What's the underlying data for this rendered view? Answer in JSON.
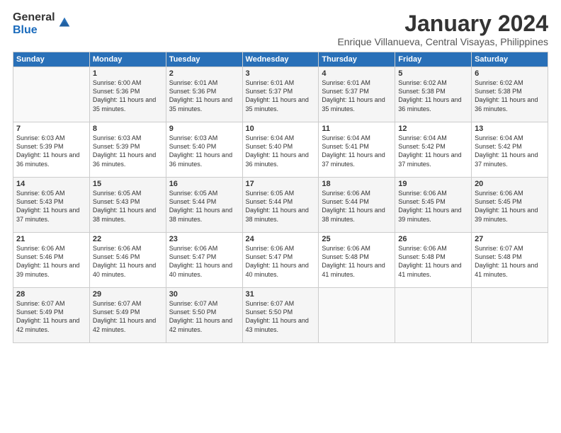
{
  "logo": {
    "general": "General",
    "blue": "Blue"
  },
  "title": "January 2024",
  "subtitle": "Enrique Villanueva, Central Visayas, Philippines",
  "headers": [
    "Sunday",
    "Monday",
    "Tuesday",
    "Wednesday",
    "Thursday",
    "Friday",
    "Saturday"
  ],
  "weeks": [
    [
      {
        "day": "",
        "sunrise": "",
        "sunset": "",
        "daylight": ""
      },
      {
        "day": "1",
        "sunrise": "Sunrise: 6:00 AM",
        "sunset": "Sunset: 5:36 PM",
        "daylight": "Daylight: 11 hours and 35 minutes."
      },
      {
        "day": "2",
        "sunrise": "Sunrise: 6:01 AM",
        "sunset": "Sunset: 5:36 PM",
        "daylight": "Daylight: 11 hours and 35 minutes."
      },
      {
        "day": "3",
        "sunrise": "Sunrise: 6:01 AM",
        "sunset": "Sunset: 5:37 PM",
        "daylight": "Daylight: 11 hours and 35 minutes."
      },
      {
        "day": "4",
        "sunrise": "Sunrise: 6:01 AM",
        "sunset": "Sunset: 5:37 PM",
        "daylight": "Daylight: 11 hours and 35 minutes."
      },
      {
        "day": "5",
        "sunrise": "Sunrise: 6:02 AM",
        "sunset": "Sunset: 5:38 PM",
        "daylight": "Daylight: 11 hours and 36 minutes."
      },
      {
        "day": "6",
        "sunrise": "Sunrise: 6:02 AM",
        "sunset": "Sunset: 5:38 PM",
        "daylight": "Daylight: 11 hours and 36 minutes."
      }
    ],
    [
      {
        "day": "7",
        "sunrise": "Sunrise: 6:03 AM",
        "sunset": "Sunset: 5:39 PM",
        "daylight": "Daylight: 11 hours and 36 minutes."
      },
      {
        "day": "8",
        "sunrise": "Sunrise: 6:03 AM",
        "sunset": "Sunset: 5:39 PM",
        "daylight": "Daylight: 11 hours and 36 minutes."
      },
      {
        "day": "9",
        "sunrise": "Sunrise: 6:03 AM",
        "sunset": "Sunset: 5:40 PM",
        "daylight": "Daylight: 11 hours and 36 minutes."
      },
      {
        "day": "10",
        "sunrise": "Sunrise: 6:04 AM",
        "sunset": "Sunset: 5:40 PM",
        "daylight": "Daylight: 11 hours and 36 minutes."
      },
      {
        "day": "11",
        "sunrise": "Sunrise: 6:04 AM",
        "sunset": "Sunset: 5:41 PM",
        "daylight": "Daylight: 11 hours and 37 minutes."
      },
      {
        "day": "12",
        "sunrise": "Sunrise: 6:04 AM",
        "sunset": "Sunset: 5:42 PM",
        "daylight": "Daylight: 11 hours and 37 minutes."
      },
      {
        "day": "13",
        "sunrise": "Sunrise: 6:04 AM",
        "sunset": "Sunset: 5:42 PM",
        "daylight": "Daylight: 11 hours and 37 minutes."
      }
    ],
    [
      {
        "day": "14",
        "sunrise": "Sunrise: 6:05 AM",
        "sunset": "Sunset: 5:43 PM",
        "daylight": "Daylight: 11 hours and 37 minutes."
      },
      {
        "day": "15",
        "sunrise": "Sunrise: 6:05 AM",
        "sunset": "Sunset: 5:43 PM",
        "daylight": "Daylight: 11 hours and 38 minutes."
      },
      {
        "day": "16",
        "sunrise": "Sunrise: 6:05 AM",
        "sunset": "Sunset: 5:44 PM",
        "daylight": "Daylight: 11 hours and 38 minutes."
      },
      {
        "day": "17",
        "sunrise": "Sunrise: 6:05 AM",
        "sunset": "Sunset: 5:44 PM",
        "daylight": "Daylight: 11 hours and 38 minutes."
      },
      {
        "day": "18",
        "sunrise": "Sunrise: 6:06 AM",
        "sunset": "Sunset: 5:44 PM",
        "daylight": "Daylight: 11 hours and 38 minutes."
      },
      {
        "day": "19",
        "sunrise": "Sunrise: 6:06 AM",
        "sunset": "Sunset: 5:45 PM",
        "daylight": "Daylight: 11 hours and 39 minutes."
      },
      {
        "day": "20",
        "sunrise": "Sunrise: 6:06 AM",
        "sunset": "Sunset: 5:45 PM",
        "daylight": "Daylight: 11 hours and 39 minutes."
      }
    ],
    [
      {
        "day": "21",
        "sunrise": "Sunrise: 6:06 AM",
        "sunset": "Sunset: 5:46 PM",
        "daylight": "Daylight: 11 hours and 39 minutes."
      },
      {
        "day": "22",
        "sunrise": "Sunrise: 6:06 AM",
        "sunset": "Sunset: 5:46 PM",
        "daylight": "Daylight: 11 hours and 40 minutes."
      },
      {
        "day": "23",
        "sunrise": "Sunrise: 6:06 AM",
        "sunset": "Sunset: 5:47 PM",
        "daylight": "Daylight: 11 hours and 40 minutes."
      },
      {
        "day": "24",
        "sunrise": "Sunrise: 6:06 AM",
        "sunset": "Sunset: 5:47 PM",
        "daylight": "Daylight: 11 hours and 40 minutes."
      },
      {
        "day": "25",
        "sunrise": "Sunrise: 6:06 AM",
        "sunset": "Sunset: 5:48 PM",
        "daylight": "Daylight: 11 hours and 41 minutes."
      },
      {
        "day": "26",
        "sunrise": "Sunrise: 6:06 AM",
        "sunset": "Sunset: 5:48 PM",
        "daylight": "Daylight: 11 hours and 41 minutes."
      },
      {
        "day": "27",
        "sunrise": "Sunrise: 6:07 AM",
        "sunset": "Sunset: 5:48 PM",
        "daylight": "Daylight: 11 hours and 41 minutes."
      }
    ],
    [
      {
        "day": "28",
        "sunrise": "Sunrise: 6:07 AM",
        "sunset": "Sunset: 5:49 PM",
        "daylight": "Daylight: 11 hours and 42 minutes."
      },
      {
        "day": "29",
        "sunrise": "Sunrise: 6:07 AM",
        "sunset": "Sunset: 5:49 PM",
        "daylight": "Daylight: 11 hours and 42 minutes."
      },
      {
        "day": "30",
        "sunrise": "Sunrise: 6:07 AM",
        "sunset": "Sunset: 5:50 PM",
        "daylight": "Daylight: 11 hours and 42 minutes."
      },
      {
        "day": "31",
        "sunrise": "Sunrise: 6:07 AM",
        "sunset": "Sunset: 5:50 PM",
        "daylight": "Daylight: 11 hours and 43 minutes."
      },
      {
        "day": "",
        "sunrise": "",
        "sunset": "",
        "daylight": ""
      },
      {
        "day": "",
        "sunrise": "",
        "sunset": "",
        "daylight": ""
      },
      {
        "day": "",
        "sunrise": "",
        "sunset": "",
        "daylight": ""
      }
    ]
  ]
}
